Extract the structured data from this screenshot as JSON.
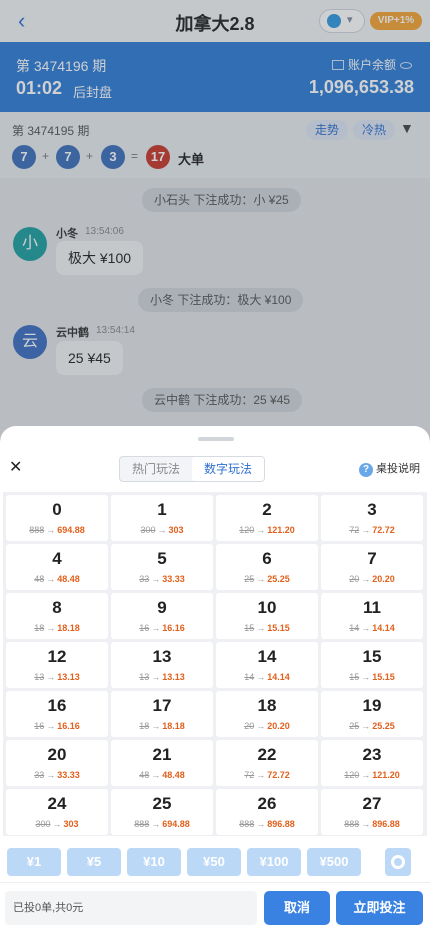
{
  "header": {
    "back_icon": "chevron-left-icon",
    "title": "加拿大2.8",
    "vip_badge": "VIP+1%",
    "globe_icon": "globe-icon"
  },
  "period": {
    "label": "第 3474196 期",
    "countdown": "01:02",
    "countdown_suffix": "后封盘",
    "balance_label": "账户余额",
    "balance_value": "1,096,653.38"
  },
  "last_result": {
    "period_label": "第 3474195 期",
    "balls": [
      "7",
      "7",
      "3"
    ],
    "ops": [
      "+",
      "+",
      "="
    ],
    "sum": "17",
    "tag": "大单",
    "trend_btn": "走势",
    "hot_btn": "冷热"
  },
  "chat": {
    "messages": [
      {
        "type": "system",
        "text": "小石头 下注成功：小 ¥25"
      },
      {
        "type": "user",
        "avatar": "小",
        "name": "小冬",
        "time": "13:54:06",
        "text": "极大 ¥100"
      },
      {
        "type": "system",
        "text": "小冬 下注成功：极大 ¥100"
      },
      {
        "type": "user",
        "avatar": "云",
        "name": "云中鹤",
        "time": "13:54:14",
        "text": "25 ¥45"
      },
      {
        "type": "system",
        "text": "云中鹤 下注成功：25 ¥45"
      }
    ]
  },
  "sheet": {
    "tabs": [
      "热门玩法",
      "数字玩法"
    ],
    "active_tab": 1,
    "help": "桌投说明",
    "cells": [
      {
        "num": "0",
        "old": "888",
        "new": "694.88"
      },
      {
        "num": "1",
        "old": "300",
        "new": "303"
      },
      {
        "num": "2",
        "old": "120",
        "new": "121.20"
      },
      {
        "num": "3",
        "old": "72",
        "new": "72.72"
      },
      {
        "num": "4",
        "old": "48",
        "new": "48.48"
      },
      {
        "num": "5",
        "old": "33",
        "new": "33.33"
      },
      {
        "num": "6",
        "old": "25",
        "new": "25.25"
      },
      {
        "num": "7",
        "old": "20",
        "new": "20.20"
      },
      {
        "num": "8",
        "old": "18",
        "new": "18.18"
      },
      {
        "num": "9",
        "old": "16",
        "new": "16.16"
      },
      {
        "num": "10",
        "old": "15",
        "new": "15.15"
      },
      {
        "num": "11",
        "old": "14",
        "new": "14.14"
      },
      {
        "num": "12",
        "old": "13",
        "new": "13.13"
      },
      {
        "num": "13",
        "old": "13",
        "new": "13.13"
      },
      {
        "num": "14",
        "old": "14",
        "new": "14.14"
      },
      {
        "num": "15",
        "old": "15",
        "new": "15.15"
      },
      {
        "num": "16",
        "old": "16",
        "new": "16.16"
      },
      {
        "num": "17",
        "old": "18",
        "new": "18.18"
      },
      {
        "num": "18",
        "old": "20",
        "new": "20.20"
      },
      {
        "num": "19",
        "old": "25",
        "new": "25.25"
      },
      {
        "num": "20",
        "old": "33",
        "new": "33.33"
      },
      {
        "num": "21",
        "old": "48",
        "new": "48.48"
      },
      {
        "num": "22",
        "old": "72",
        "new": "72.72"
      },
      {
        "num": "23",
        "old": "120",
        "new": "121.20"
      },
      {
        "num": "24",
        "old": "300",
        "new": "303"
      },
      {
        "num": "25",
        "old": "888",
        "new": "694.88"
      },
      {
        "num": "26",
        "old": "888",
        "new": "896.88"
      },
      {
        "num": "27",
        "old": "888",
        "new": "896.88"
      }
    ],
    "amounts": [
      "¥1",
      "¥5",
      "¥10",
      "¥50",
      "¥100",
      "¥500"
    ],
    "summary": "已投0单,共0元",
    "cancel": "取消",
    "submit": "立即投注"
  },
  "colors": {
    "accent": "#2f7dd6",
    "odds": "#e2601c",
    "ball_blue": "#3d6fbb",
    "ball_red": "#c9372b",
    "vip": "#f4a534"
  }
}
